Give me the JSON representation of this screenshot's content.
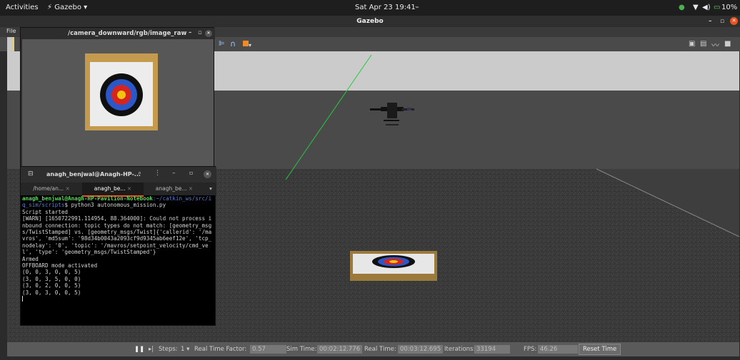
{
  "topbar": {
    "activities": "Activities",
    "app_menu": "Gazebo",
    "app_menu_chevron": "▾",
    "clock": "Sat Apr 23  19:41",
    "battery": "10%"
  },
  "gazebo": {
    "title": "Gazebo",
    "menu_file": "File",
    "statusbar": {
      "steps_label": "Steps:",
      "steps_value": "1",
      "rtf_label": "Real Time Factor:",
      "rtf_value": "0.57",
      "sim_time_label": "Sim Time:",
      "sim_time_value": "00:02:12.776",
      "real_time_label": "Real Time:",
      "real_time_value": "00:03:12.695",
      "iterations_label": "Iterations:",
      "iterations_value": "33194",
      "fps_label": "FPS:",
      "fps_value": "46.26",
      "reset_time": "Reset Time"
    }
  },
  "camera_window": {
    "title": "/camera_downward/rgb/image_raw"
  },
  "terminal": {
    "title": "anagh_benjwal@Anagh-HP-...",
    "tabs": [
      "/home/an...",
      "anagh_be...",
      "anagh_be..."
    ],
    "prompt_user": "anagh_benjwal@Anagh-HP-Pavilion-Notebook",
    "prompt_path": ":~/catkin_ws/src/iq_sim/scripts",
    "command": "$ python3 autonomous_mission.py",
    "lines": [
      "Script started",
      "[WARN] [1650722991.114954, 88.364000]: Could not process inbound connection: topic types do not match: [geometry_msgs/TwistStamped] vs. [geometry_msgs/Twist]{'callerid': '/mavros', 'md5sum': '98d34b0043a2093cf9d9345ab6eef12e', 'tcp_nodelay': '0', 'topic': '/mavros/setpoint_velocity/cmd_vel', 'type': 'geometry_msgs/TwistStamped'}",
      "Armed",
      "OFFBOARD mode activated",
      "(0, 0, 3, 0, 0, 5)",
      "(3, 0, 3, 5, 0, 0)",
      "(3, 0, 2, 0, 0, 5)",
      "(3, 0, 3, 0, 0, 5)"
    ]
  }
}
